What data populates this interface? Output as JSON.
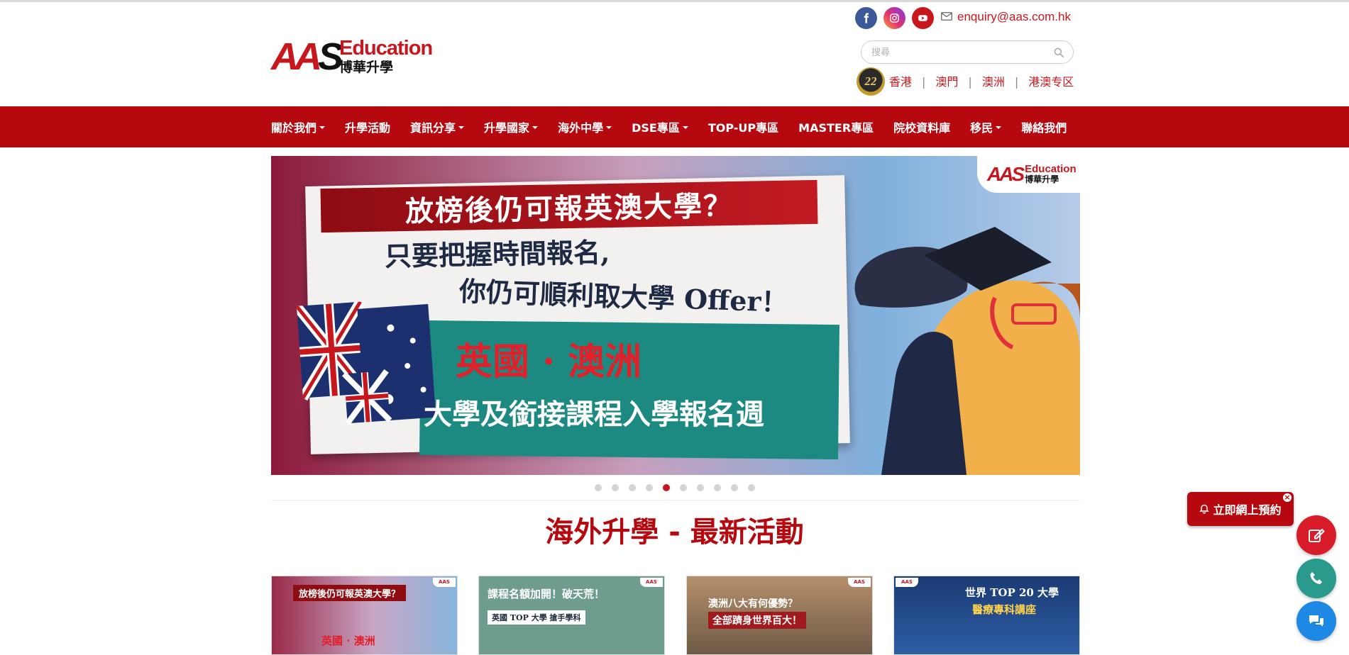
{
  "header": {
    "logo": {
      "mark": "AAS",
      "brand": "Education",
      "chinese": "博華升學"
    },
    "social": [
      "facebook-icon",
      "instagram-icon",
      "youtube-icon"
    ],
    "email": "enquiry@aas.com.hk",
    "search": {
      "placeholder": "搜尋"
    },
    "anniversary_badge": "22",
    "regions": [
      "香港",
      "澳門",
      "澳洲",
      "港澳专区"
    ],
    "region_separator": "|"
  },
  "nav": {
    "items": [
      {
        "label": "關於我們",
        "dropdown": true
      },
      {
        "label": "升學活動",
        "dropdown": false
      },
      {
        "label": "資訊分享",
        "dropdown": true
      },
      {
        "label": "升學國家",
        "dropdown": true
      },
      {
        "label": "海外中學",
        "dropdown": true
      },
      {
        "label": "DSE專區",
        "dropdown": true
      },
      {
        "label": "TOP-UP專區",
        "dropdown": false
      },
      {
        "label": "MASTER專區",
        "dropdown": false
      },
      {
        "label": "院校資料庫",
        "dropdown": false
      },
      {
        "label": "移民",
        "dropdown": true
      },
      {
        "label": "聯絡我們",
        "dropdown": false
      }
    ]
  },
  "banner": {
    "headline": "放榜後仍可報英澳大學？",
    "line1": "只要把握時間報名,",
    "line2": "你仍可順利取大學 Offer！",
    "countries": "英國 · 澳洲",
    "bottom": "大學及銜接課程入學報名週",
    "logo_mark": "AAS",
    "logo_brand": "Education",
    "logo_cn": "博華升學"
  },
  "carousel": {
    "total": 10,
    "active": 5
  },
  "section": {
    "title": "海外升學 - 最新活動"
  },
  "cards": [
    {
      "title": "放榜後仍可報英澳大學？",
      "sub": "英國 · 澳洲"
    },
    {
      "title": "課程名額加開！破天荒！",
      "sub": "英國 TOP 大學 搶手學科"
    },
    {
      "title": "澳洲八大有何優勢？",
      "sub": "全部躋身世界百大！"
    },
    {
      "title": "世界 TOP 20 大學",
      "sub": "醫療專科講座"
    }
  ],
  "floating": {
    "book_label": "立即網上預約",
    "close": "×"
  },
  "colors": {
    "brand_red": "#b5090f",
    "accent_red": "#c8161d",
    "phone_green": "#2a9a8c",
    "chat_blue": "#1e88e5"
  }
}
